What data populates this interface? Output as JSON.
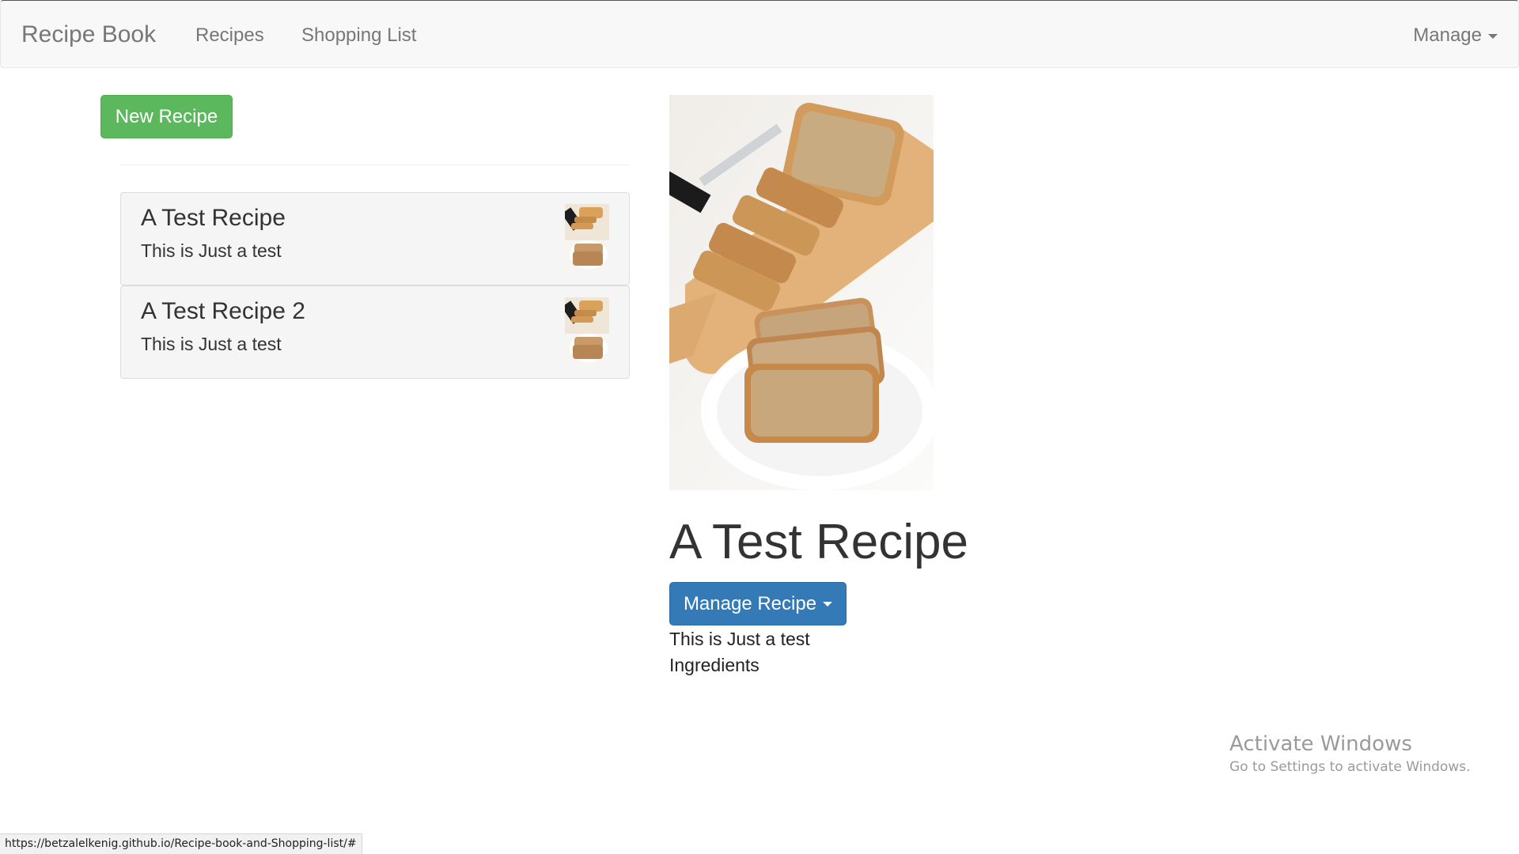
{
  "navbar": {
    "brand": "Recipe Book",
    "links": [
      "Recipes",
      "Shopping List"
    ],
    "manage_label": "Manage"
  },
  "sidebar": {
    "new_recipe_label": "New Recipe",
    "recipes": [
      {
        "name": "A Test Recipe",
        "description": "This is Just a test",
        "image": "bread-icon"
      },
      {
        "name": "A Test Recipe 2",
        "description": "This is Just a test",
        "image": "bread-icon"
      }
    ]
  },
  "detail": {
    "image": "sliced-bread-photo",
    "title": "A Test Recipe",
    "manage_label": "Manage Recipe",
    "description": "This is Just a test",
    "ingredients_label": "Ingredients"
  },
  "watermark": {
    "title": "Activate Windows",
    "subtitle": "Go to Settings to activate Windows."
  },
  "status_bar": {
    "url": "https://betzalelkenig.github.io/Recipe-book-and-Shopping-list/#"
  },
  "colors": {
    "success": "#5cb85c",
    "primary": "#337ab7",
    "navbar_bg": "#f8f8f8"
  }
}
